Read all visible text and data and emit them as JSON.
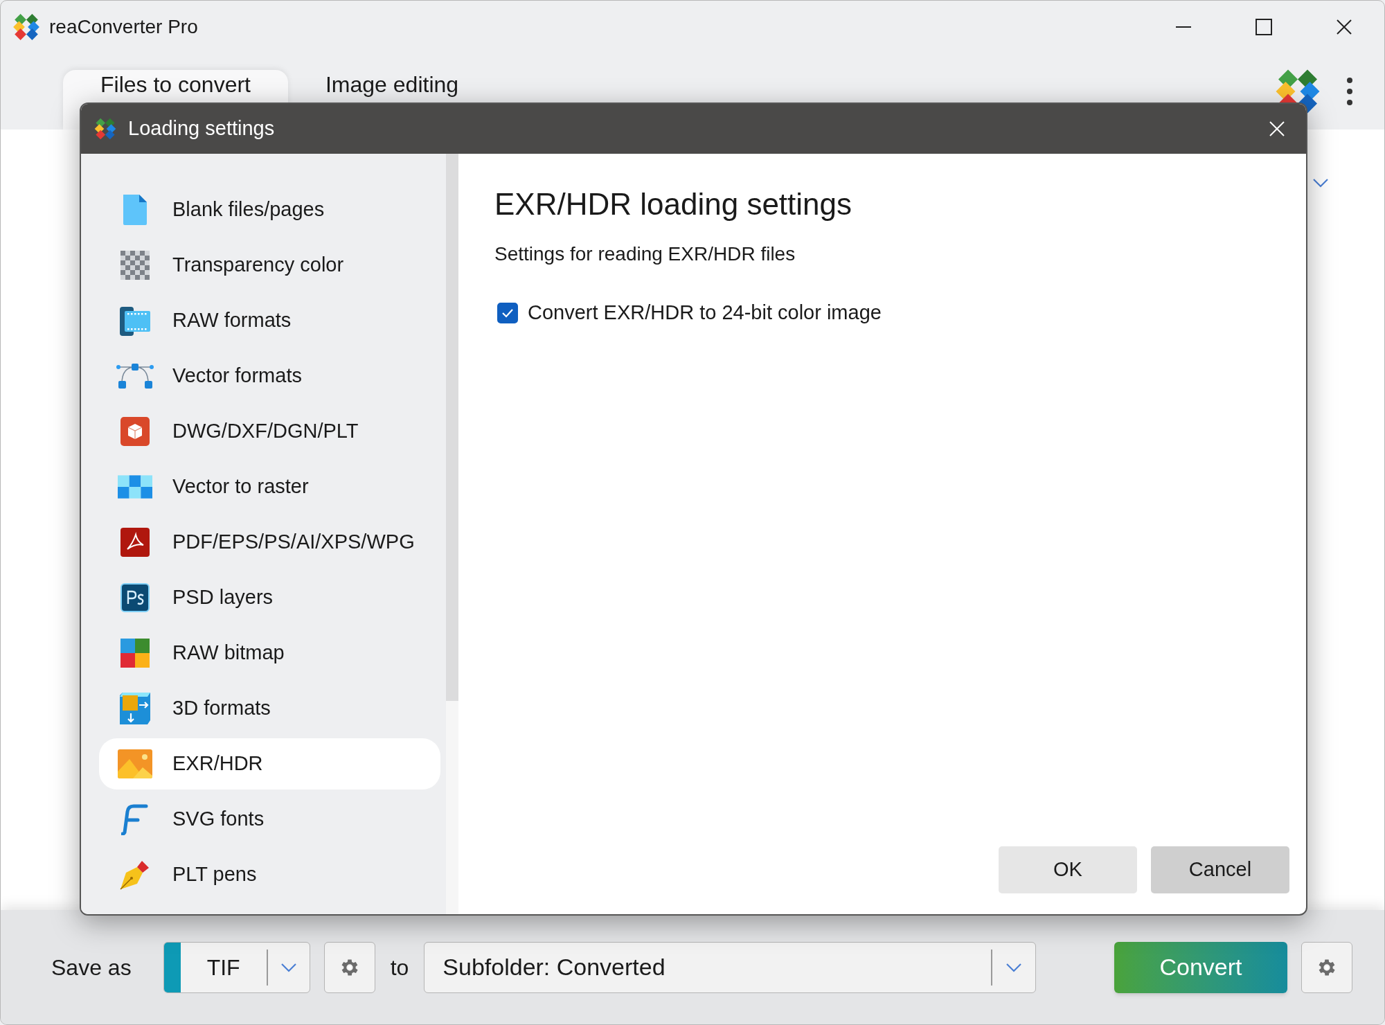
{
  "window": {
    "title": "reaConverter Pro"
  },
  "tabs": [
    {
      "label": "Files to convert",
      "selected": true
    },
    {
      "label": "Image editing",
      "selected": false
    }
  ],
  "dialog": {
    "title": "Loading settings",
    "sidebar": [
      {
        "label": "Blank files/pages",
        "selected": false
      },
      {
        "label": "Transparency color",
        "selected": false
      },
      {
        "label": "RAW formats",
        "selected": false
      },
      {
        "label": "Vector formats",
        "selected": false
      },
      {
        "label": "DWG/DXF/DGN/PLT",
        "selected": false
      },
      {
        "label": "Vector to raster",
        "selected": false
      },
      {
        "label": "PDF/EPS/PS/AI/XPS/WPG",
        "selected": false
      },
      {
        "label": "PSD layers",
        "selected": false
      },
      {
        "label": "RAW bitmap",
        "selected": false
      },
      {
        "label": "3D formats",
        "selected": false
      },
      {
        "label": "EXR/HDR",
        "selected": true
      },
      {
        "label": "SVG fonts",
        "selected": false
      },
      {
        "label": "PLT pens",
        "selected": false
      }
    ],
    "heading": "EXR/HDR loading settings",
    "subtitle": "Settings for reading EXR/HDR files",
    "options": [
      {
        "label": "Convert EXR/HDR to 24-bit color image",
        "checked": true
      }
    ],
    "buttons": [
      "OK",
      "Cancel"
    ]
  },
  "bottom_bar": {
    "save_as_label": "Save as",
    "format": "TIF",
    "to_label": "to",
    "destination": "Subfolder: Converted",
    "convert": "Convert"
  }
}
